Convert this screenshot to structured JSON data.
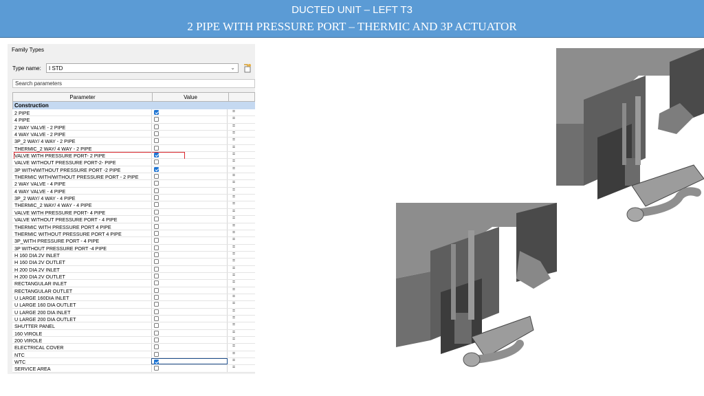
{
  "banner": {
    "title_line1": "DUCTED UNIT – LEFT T3",
    "title_line2": "2 PIPE WITH PRESSURE PORT – THERMIC AND 3P ACTUATOR",
    "background": "#5b9bd5"
  },
  "family_types": {
    "title": "Family Types",
    "type_name_label": "Type name:",
    "type_name_value": "I STD",
    "search_placeholder": "Search parameters",
    "columns": {
      "parameter": "Parameter",
      "value": "Value"
    },
    "group_label": "Construction",
    "rows": [
      {
        "name": "2 PIPE",
        "checked": true
      },
      {
        "name": "4 PIPE",
        "checked": false
      },
      {
        "name": "2 WAY  VALVE - 2 PIPE",
        "checked": false
      },
      {
        "name": "4 WAY VALVE - 2 PIPE",
        "checked": false
      },
      {
        "name": "3P_2 WAY/ 4 WAY - 2 PIPE",
        "checked": false
      },
      {
        "name": "THERMIC_2 WAY/ 4 WAY - 2 PIPE",
        "checked": false
      },
      {
        "name": "VALVE WITH PRESSURE PORT- 2 PIPE",
        "checked": true,
        "highlighted": true
      },
      {
        "name": "VALVE WITHOUT PRESSURE PORT-2- PIPE",
        "checked": false
      },
      {
        "name": "3P WITH/WITHOUT PRESSURE PORT -2 PIPE",
        "checked": true
      },
      {
        "name": "THERMIC WITH/WITHOUT PRESSURE PORT - 2 PIPE",
        "checked": false
      },
      {
        "name": "2 WAY VALVE - 4 PIPE",
        "checked": false
      },
      {
        "name": "4 WAY VALVE - 4 PIPE",
        "checked": false
      },
      {
        "name": "3P_2 WAY/ 4 WAY - 4 PIPE",
        "checked": false
      },
      {
        "name": "THERMIC_2 WAY/ 4 WAY - 4 PIPE",
        "checked": false
      },
      {
        "name": "VALVE WITH PRESSURE PORT- 4 PIPE",
        "checked": false
      },
      {
        "name": "VALVE WITHOUT PRESSURE PORT - 4 PIPE",
        "checked": false
      },
      {
        "name": "THERMIC WITH PRESSURE PORT 4 PIPE",
        "checked": false
      },
      {
        "name": "THERMIC WITHOUT PRESSURE PORT  4 PIPE",
        "checked": false
      },
      {
        "name": "3P_WITH PRESSURE PORT - 4 PIPE",
        "checked": false
      },
      {
        "name": "3P WITHOUT PRESSURE PORT -4  PIPE",
        "checked": false
      },
      {
        "name": "H 160 DIA 2V INLET",
        "checked": false
      },
      {
        "name": "H 160 DIA 2V OUTLET",
        "checked": false
      },
      {
        "name": "H 200 DIA 2V INLET",
        "checked": false
      },
      {
        "name": "H 200 DIA 2V OUTLET",
        "checked": false
      },
      {
        "name": "RECTANGULAR INLET",
        "checked": false
      },
      {
        "name": "RECTANGULAR  OUTLET",
        "checked": false
      },
      {
        "name": "U LARGE 160DIA INLET",
        "checked": false
      },
      {
        "name": "U LARGE 160 DIA OUTLET",
        "checked": false
      },
      {
        "name": "U LARGE 200 DIA INLET",
        "checked": false
      },
      {
        "name": "U LARGE 200 DIA OUTLET",
        "checked": false
      },
      {
        "name": "SHUTTER PANEL",
        "checked": false
      },
      {
        "name": "160 VIROLE",
        "checked": false
      },
      {
        "name": "200 VIROLE",
        "checked": false
      },
      {
        "name": "ELECTRICAL COVER",
        "checked": false
      },
      {
        "name": "NTC",
        "checked": false
      },
      {
        "name": "WTC",
        "checked": true,
        "selected": true
      },
      {
        "name": "SERVICE AREA",
        "checked": false
      }
    ],
    "formula_symbol": "="
  },
  "colors": {
    "checkbox_checked": "#1e74d2",
    "highlight_outline": "#d9252b",
    "group_header": "#c5d9f1"
  }
}
